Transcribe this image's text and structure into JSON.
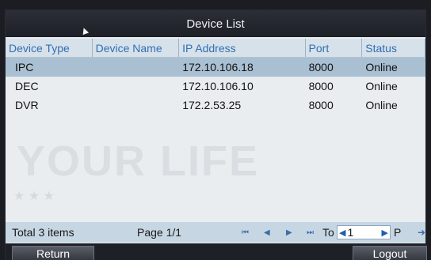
{
  "window": {
    "title": "Device List"
  },
  "table": {
    "headers": [
      "Device Type",
      "Device Name",
      "IP Address",
      "Port",
      "Status"
    ],
    "rows": [
      {
        "type": "IPC",
        "name": "",
        "ip": "172.10.106.18",
        "port": "8000",
        "status": "Online"
      },
      {
        "type": "DEC",
        "name": "",
        "ip": "172.10.106.10",
        "port": "8000",
        "status": "Online"
      },
      {
        "type": "DVR",
        "name": "",
        "ip": "172.2.53.25",
        "port": "8000",
        "status": "Online"
      }
    ]
  },
  "footer": {
    "total": "Total 3 items",
    "page": "Page 1/1",
    "to_label": "To",
    "page_input_value": "1",
    "p_label": "P"
  },
  "buttons": {
    "return_label": "Return",
    "logout_label": "Logout"
  },
  "watermark": {
    "text": "YOUR LIFE"
  },
  "colors": {
    "header_text": "#2f6fb4",
    "selected_row": "#a9c0d3",
    "footer_bg": "#c7d6e3"
  }
}
